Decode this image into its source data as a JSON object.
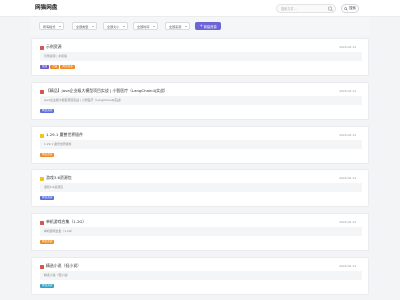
{
  "header": {
    "brand": "网猫网盘",
    "search_placeholder": "搜索文件...",
    "search_button": "搜索"
  },
  "filters": {
    "items": [
      "所有格式",
      "全部类型",
      "全部大小",
      "全部时间",
      "全部来源"
    ],
    "create_button": "新建资源"
  },
  "colors": {
    "accent": "#6e64d8",
    "tag_purple": "#6a5acd",
    "tag_orange": "#f08c28",
    "tag_blue": "#5b6ee1",
    "tag_cyan": "#2ea3c8",
    "icon_red": "#d9534f",
    "icon_yellow": "#f0c419"
  },
  "cards": [
    {
      "icon": "red",
      "title": "示例资源",
      "date": "2024-02-14",
      "desc": "示例资源 | 手机版",
      "tags": [
        {
          "label": "视频",
          "color": "#6a5acd"
        },
        {
          "label": "合集",
          "color": "#f08c28"
        },
        {
          "label": "网盘资源",
          "color": "#f08c28"
        }
      ]
    },
    {
      "icon": "red",
      "title": "【精品】Java企业级大模型项目实战 | 小智医疗（LangChain4j实战）",
      "date": "2024-02-14",
      "desc": "Java企业级大模型项目实战 | 小智医疗（LangChain4j实战）",
      "tags": [
        {
          "label": "网盘资源",
          "color": "#5b6ee1"
        }
      ]
    },
    {
      "icon": "yellow",
      "title": "1.29.1 魔兽世界插件",
      "date": "2024-02-14",
      "desc": "1.29.1 魔兽世界插件",
      "tags": [
        {
          "label": "网盘资源",
          "color": "#f08c28"
        }
      ]
    },
    {
      "icon": "yellow",
      "title": "游戏3.6资源包",
      "date": "2024-02-14",
      "desc": "游戏3.6资源包",
      "tags": [
        {
          "label": "网盘资源",
          "color": "#5b6ee1"
        }
      ]
    },
    {
      "icon": "red",
      "title": "单机游戏合集（1.2G）",
      "date": "2024-02-14",
      "desc": "单机游戏合集（1.2G）",
      "tags": [
        {
          "label": "网盘资源",
          "color": "#f08c28"
        }
      ]
    },
    {
      "icon": "red",
      "title": "精选小说（轻小说）",
      "date": "2024-02-14",
      "desc": "精选小说（轻小说）",
      "tags": [
        {
          "label": "网盘资源",
          "color": "#2ea3c8"
        }
      ]
    }
  ]
}
